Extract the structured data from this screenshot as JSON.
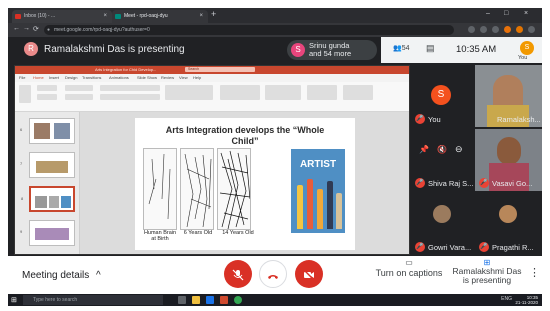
{
  "browser": {
    "tabs": [
      {
        "label": "Inbox (10) - ...",
        "active": false
      },
      {
        "label": "Meet - rpd-oaqj-dyu",
        "active": true
      }
    ],
    "new_tab": "+",
    "window_controls": [
      "–",
      "□",
      "×"
    ],
    "url": "meet.google.com/rpd-oaqj-dyu?authuser=0",
    "nav": [
      "←",
      "→",
      "⟳"
    ]
  },
  "meet": {
    "presenter_initial": "R",
    "presenting_label": "Ramalakshmi Das is presenting",
    "participants_pill": {
      "initial": "S",
      "line1": "Srinu gunda",
      "line2": "and 54 more"
    },
    "people_count": "54",
    "time": "10:35 AM",
    "user_initial": "S",
    "user_label": "You"
  },
  "presentation": {
    "window_title": "Arts Integration for Chid Develop...",
    "search_placeholder": "Search",
    "menu": [
      "File",
      "Home",
      "Insert",
      "Design",
      "Transitions",
      "Animations",
      "Slide Show",
      "Review",
      "View",
      "Help"
    ],
    "thumb_numbers": [
      "6",
      "7",
      "8",
      "9"
    ],
    "slide": {
      "title_line1": "Arts Integration develops the “Whole",
      "title_line2": "Child”",
      "captions": [
        "Human Brain at Birth",
        "6 Years Old",
        "14 Years Old"
      ],
      "book_title": "ARTIST"
    }
  },
  "participants": [
    {
      "name": "Ramalaksh...",
      "kind": "photo"
    },
    {
      "name": "You",
      "initial": "S",
      "kind": "avatar"
    },
    {
      "name": "Shiva Raj S...",
      "kind": "blank"
    },
    {
      "name": "Vasavi Go...",
      "kind": "photo"
    },
    {
      "name": "Gowri Vara...",
      "kind": "photo"
    },
    {
      "name": "Pragathi R...",
      "kind": "photo"
    }
  ],
  "bottom": {
    "meeting_details": "Meeting details",
    "chevron": "^",
    "captions_label": "Turn on captions",
    "present_label_line1": "Ramalakshmi Das",
    "present_label_line2": "is presenting",
    "more": "⋮"
  },
  "taskbar": {
    "search_placeholder": "Type here to search",
    "tray": "ENG",
    "clock_time": "10:35",
    "clock_date": "21-11-2020"
  },
  "colors": {
    "end_call": "#d93025",
    "accent": "#1a73e8",
    "ppt_brand": "#c8472e"
  }
}
